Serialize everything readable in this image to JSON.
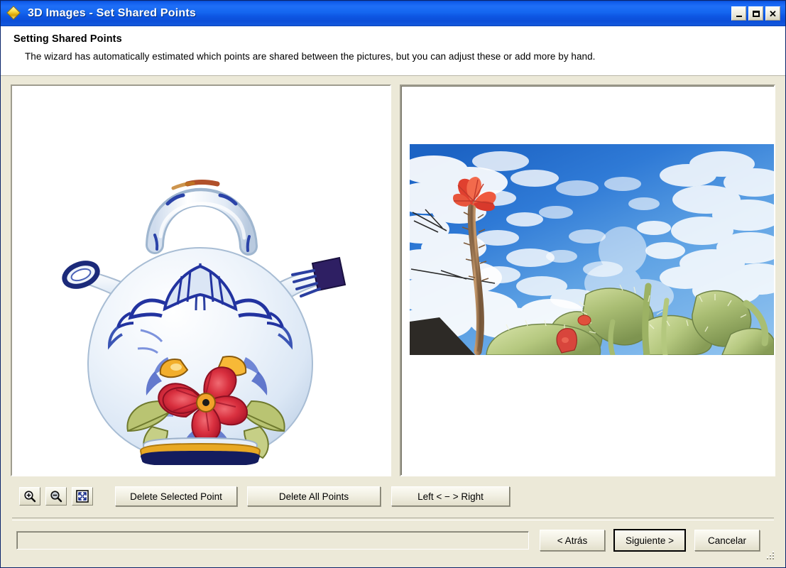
{
  "window": {
    "title_app": "3D Images",
    "title_sep": "-",
    "title_page": "Set Shared Points",
    "title_full": "3D Images  -  Set Shared Points",
    "icon": "diamond-gem-icon",
    "accent_title_bar": "#0d55e2",
    "accent_face": "#ece9d8",
    "controls": {
      "minimize": "minimize-icon",
      "maximize": "maximize-icon",
      "close": "close-icon"
    }
  },
  "header": {
    "title": "Setting Shared Points",
    "subtitle": "The wizard has automatically estimated which points are shared between the pictures, but you can adjust these or add more by hand."
  },
  "panels": {
    "left": {
      "name": "left-image-panel",
      "content": "photo-ceramic-jug",
      "description": "Blue and white hand-painted ceramic jug with arched handle, two spouts and a red flower motif on a white background"
    },
    "right": {
      "name": "right-image-panel",
      "content": "photo-cactus-sky",
      "description": "Prickly pear cactus pads against a blue sky with white clouds and a tall stalk topped by a red flower"
    }
  },
  "toolbar": {
    "zoom_in": "zoom-in-icon",
    "zoom_out": "zoom-out-icon",
    "fit": "fit-to-window-icon",
    "delete_selected_point": "Delete Selected Point",
    "delete_all_points": "Delete All Points",
    "swap_left_right": "Left < − > Right"
  },
  "footer": {
    "progress_value": "",
    "back": "< Atrás",
    "next": "Siguiente >",
    "cancel": "Cancelar",
    "grip": "resize-grip-icon"
  }
}
